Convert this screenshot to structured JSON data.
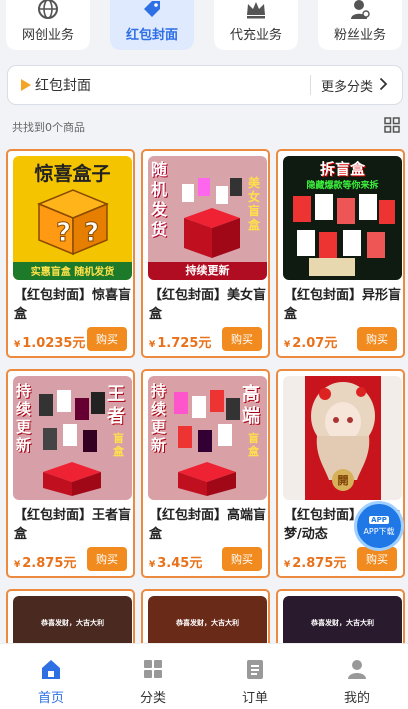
{
  "categories": [
    {
      "label": "网创业务",
      "icon": "globe-icon",
      "active": false
    },
    {
      "label": "红包封面",
      "icon": "tag-icon",
      "active": true
    },
    {
      "label": "代充业务",
      "icon": "crown-icon",
      "active": false
    },
    {
      "label": "粉丝业务",
      "icon": "user-icon",
      "active": false
    }
  ],
  "breadcrumb": {
    "current": "红包封面",
    "more": "更多分类"
  },
  "count_text": "共找到0个商品",
  "currency": "¥",
  "buy_label": "购买",
  "products": [
    {
      "title": "【红包封面】惊喜盲盒",
      "price": "1.0235元",
      "img_text": "惊喜盒子",
      "img_sub": "实惠盲盒 随机发货"
    },
    {
      "title": "【红包封面】美女盲盒",
      "price": "1.725元",
      "img_text": "随机发货",
      "img_sub": "持续更新",
      "img_side": "美女盲盒"
    },
    {
      "title": "【红包封面】异形盲盒",
      "price": "2.07元",
      "img_text": "拆盲盒",
      "img_sub": "隐藏爆款等你来拆"
    },
    {
      "title": "【红包封面】王者盲盒",
      "price": "2.875元",
      "img_text": "持续更新",
      "img_side": "王者",
      "img_sub": "盲盒"
    },
    {
      "title": "【红包封面】高端盲盒",
      "price": "3.45元",
      "img_text": "持续更新",
      "img_side": "高端",
      "img_sub": "盲盒"
    },
    {
      "title": "【红包封面】天鹅之梦/动态",
      "price": "2.875元",
      "img_text": "開"
    }
  ],
  "partial_row": [
    {
      "caption": "恭喜发财，大吉大利"
    },
    {
      "caption": "恭喜发财，大吉大利"
    },
    {
      "caption": "恭喜发财，大吉大利"
    }
  ],
  "app_download": {
    "badge": "APP",
    "label": "APP下载"
  },
  "nav": [
    {
      "label": "首页",
      "icon": "home-icon",
      "active": true
    },
    {
      "label": "分类",
      "icon": "grid-icon",
      "active": false
    },
    {
      "label": "订单",
      "icon": "clipboard-icon",
      "active": false
    },
    {
      "label": "我的",
      "icon": "profile-icon",
      "active": false
    }
  ],
  "colors": {
    "accent": "#2f6fe4",
    "price": "#e8721b",
    "buy": "#f28b1f",
    "card_border": "#ec8a3f"
  }
}
